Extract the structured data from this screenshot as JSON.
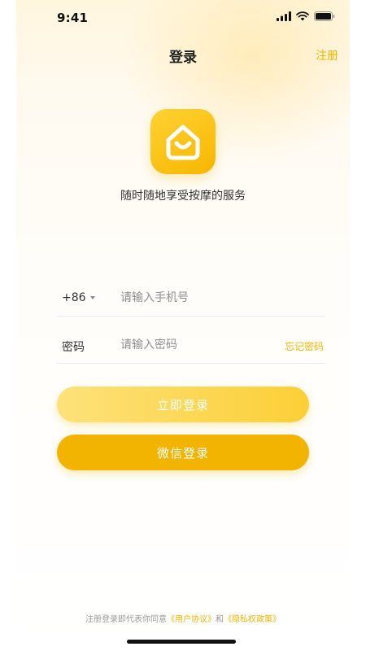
{
  "status_bar": {
    "time": "9:41",
    "icons": [
      "signal-icon",
      "wifi-icon",
      "battery-icon"
    ]
  },
  "nav": {
    "title": "登录",
    "register": "注册"
  },
  "brand": {
    "logo_icon": "house-smile-icon",
    "slogan": "随时随地享受按摩的服务"
  },
  "form": {
    "country_code": "+86",
    "phone_placeholder": "请输入手机号",
    "password_label": "密码",
    "password_placeholder": "请输入密码",
    "forgot": "忘记密码"
  },
  "buttons": {
    "login": "立即登录",
    "wechat": "微信登录"
  },
  "footer": {
    "prefix": "注册登录即代表你同意",
    "user_agreement": "《用户协议》",
    "and": "和",
    "privacy_policy": "《隐私权政策》"
  },
  "colors": {
    "accent": "#f2b400",
    "login_button_start": "#fde27a",
    "login_button_end": "#fccf36",
    "background_tint": "#fff6de"
  }
}
